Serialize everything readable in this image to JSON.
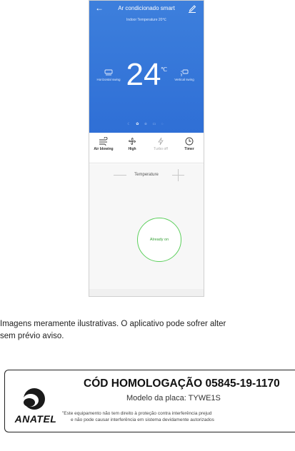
{
  "app": {
    "title": "Ar condicionado smart",
    "indoor_temperature": "Indoor Temperature 20℃",
    "target_temperature": "24",
    "temperature_unit": "℃",
    "horizontal_swing": "Horizontal swing",
    "vertical_swing": "Vertical swing",
    "modes": [
      "☾",
      "✿",
      "※",
      "▭",
      "◌"
    ],
    "controls": [
      {
        "label": "Air blowing",
        "icon": "wind-icon",
        "enabled": true
      },
      {
        "label": "High",
        "icon": "fan-icon",
        "enabled": true
      },
      {
        "label": "Turbo off",
        "icon": "lightning-icon",
        "enabled": false
      },
      {
        "label": "Timer",
        "icon": "clock-icon",
        "enabled": true
      }
    ],
    "temperature_label": "Temperature",
    "power_status": "Already on",
    "accent_color": "#2f6fd6",
    "power_color": "#5ccf5c"
  },
  "caption": {
    "line1": "Imagens meramente ilustrativas. O aplicativo pode sofrer alter",
    "line2": "sem prévio aviso."
  },
  "anatel": {
    "logo_text": "ANATEL",
    "code": "CÓD HOMOLOGAÇÃO 05845-19-1170",
    "model": "Modelo da placa: TYWE1S",
    "disclaimer1": "\"Este equipamento não tem direito à proteção contra interferência prejud",
    "disclaimer2": "e não pode causar interferência em sistema devidamente autorizados"
  }
}
